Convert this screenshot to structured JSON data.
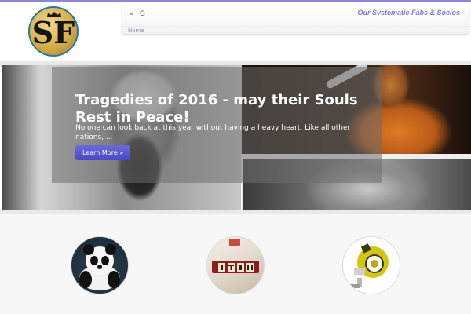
{
  "header": {
    "logo": {
      "monogram": "SF",
      "emblem": "crown"
    },
    "social": [
      {
        "icon": "rss-icon",
        "glyph": "»"
      },
      {
        "icon": "google-icon",
        "glyph": "G"
      }
    ],
    "tagline": "Our Systematic Fabs & Socios",
    "nav": {
      "home": "Home"
    }
  },
  "hero": {
    "title": "Tragedies of 2016 - may their Souls Rest in Peace!",
    "excerpt": "No one can look back at this year without having a heavy heart. Like all other nations, ...",
    "button_label": "Learn More »"
  },
  "features": [
    {
      "name": "panda-image"
    },
    {
      "name": "scrabble-tiles-image"
    },
    {
      "name": "yellow-robot-image"
    }
  ],
  "colors": {
    "accent": "#7d7ad8",
    "button": "#5a58cc",
    "top_line": "#8b86d6"
  }
}
